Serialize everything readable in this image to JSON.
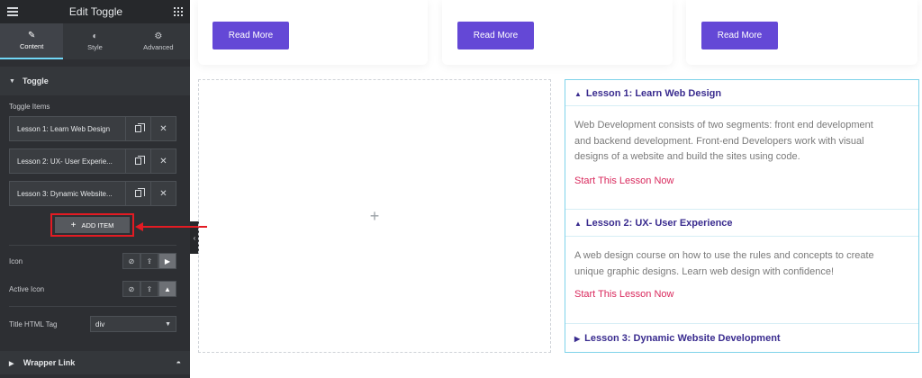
{
  "editor": {
    "title": "Edit Toggle",
    "tabs": [
      {
        "label": "Content",
        "icon": "pencil-icon",
        "active": true
      },
      {
        "label": "Style",
        "icon": "half-circle-icon",
        "active": false
      },
      {
        "label": "Advanced",
        "icon": "gear-icon",
        "active": false
      }
    ],
    "section": "Toggle",
    "toggle_items_label": "Toggle Items",
    "items": [
      {
        "label": "Lesson 1: Learn Web Design"
      },
      {
        "label": "Lesson 2: UX- User Experie..."
      },
      {
        "label": "Lesson 3: Dynamic Website..."
      }
    ],
    "add_item": "ADD ITEM",
    "icon_label": "Icon",
    "active_icon_label": "Active Icon",
    "title_tag_label": "Title HTML Tag",
    "title_tag_value": "div",
    "wrapper_link": "Wrapper Link"
  },
  "cards": [
    {
      "button": "Read More"
    },
    {
      "button": "Read More"
    },
    {
      "button": "Read More"
    }
  ],
  "toggle": {
    "items": [
      {
        "title": "Lesson 1: Learn Web Design",
        "open": true,
        "body_lines": [
          "Web Development consists of two segments: front end development",
          "and backend development. Front-end Developers work with visual",
          "designs of a website and build the sites using code."
        ],
        "link": "Start This Lesson Now"
      },
      {
        "title": "Lesson 2: UX- User Experience",
        "open": true,
        "body_lines": [
          "A web design course on how to use the rules and concepts to create",
          "unique graphic designs. Learn web design with confidence!"
        ],
        "link": "Start This Lesson Now"
      },
      {
        "title": "Lesson 3: Dynamic Website Development",
        "open": false
      }
    ]
  },
  "colors": {
    "accent": "#6448d6",
    "title": "#3a2c8f",
    "link": "#d9295d",
    "highlight": "#e31b23",
    "border": "#7fd3ea"
  }
}
